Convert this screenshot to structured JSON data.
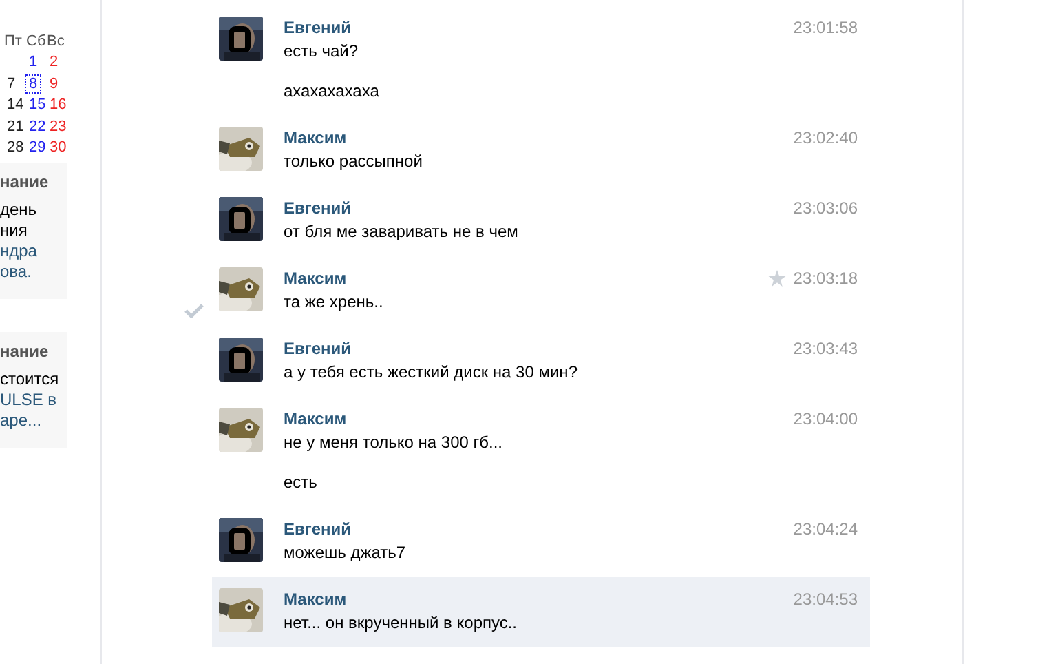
{
  "calendar": {
    "weekdays": [
      "Пт",
      "Сб",
      "Вс"
    ],
    "weeks": [
      [
        {
          "day": "1",
          "kind": "saturday",
          "selected": false
        },
        {
          "day": "2",
          "kind": "sunday",
          "selected": false
        }
      ],
      [
        {
          "day": "7",
          "kind": "weekday",
          "selected": false
        },
        {
          "day": "8",
          "kind": "saturday",
          "selected": true
        },
        {
          "day": "9",
          "kind": "sunday",
          "selected": false
        }
      ],
      [
        {
          "day": "14",
          "kind": "weekday",
          "selected": false
        },
        {
          "day": "15",
          "kind": "saturday",
          "selected": false
        },
        {
          "day": "16",
          "kind": "sunday",
          "selected": false
        }
      ],
      [
        {
          "day": "21",
          "kind": "weekday",
          "selected": false
        },
        {
          "day": "22",
          "kind": "saturday",
          "selected": false
        },
        {
          "day": "23",
          "kind": "sunday",
          "selected": false
        }
      ],
      [
        {
          "day": "28",
          "kind": "weekday",
          "selected": false
        },
        {
          "day": "29",
          "kind": "saturday",
          "selected": false
        },
        {
          "day": "30",
          "kind": "sunday",
          "selected": false
        }
      ]
    ]
  },
  "reminders": [
    {
      "title": "нание",
      "lines": [
        {
          "text": "день",
          "kind": "plain"
        },
        {
          "text": "ния",
          "kind": "plain"
        },
        {
          "text": "ндра",
          "kind": "link"
        },
        {
          "text": "ова.",
          "kind": "link"
        }
      ]
    },
    {
      "title": "нание",
      "lines": [
        {
          "text": "стоится",
          "kind": "plain"
        },
        {
          "text": "ULSE в",
          "kind": "link"
        },
        {
          "text": "аре...",
          "kind": "link"
        }
      ]
    }
  ],
  "messages": [
    {
      "sender": "Евгений",
      "time": "23:01:58",
      "texts": [
        "есть чай?",
        "ахахахахаха"
      ],
      "starred": false,
      "check_shown": false,
      "highlighted": false
    },
    {
      "sender": "Максим",
      "time": "23:02:40",
      "texts": [
        "только рассыпной"
      ],
      "starred": false,
      "check_shown": false,
      "highlighted": false
    },
    {
      "sender": "Евгений",
      "time": "23:03:06",
      "texts": [
        "от бля ме заваривать не в чем"
      ],
      "starred": false,
      "check_shown": false,
      "highlighted": false
    },
    {
      "sender": "Максим",
      "time": "23:03:18",
      "texts": [
        "та же хрень.."
      ],
      "starred": true,
      "check_shown": true,
      "highlighted": false
    },
    {
      "sender": "Евгений",
      "time": "23:03:43",
      "texts": [
        "а у тебя есть жесткий диск на 30 мин?"
      ],
      "starred": false,
      "check_shown": false,
      "highlighted": false
    },
    {
      "sender": "Максим",
      "time": "23:04:00",
      "texts": [
        "не у меня только на 300 гб...",
        "есть"
      ],
      "starred": false,
      "check_shown": false,
      "highlighted": false
    },
    {
      "sender": "Евгений",
      "time": "23:04:24",
      "texts": [
        "можешь джать7"
      ],
      "starred": false,
      "check_shown": false,
      "highlighted": false
    },
    {
      "sender": "Максим",
      "time": "23:04:53",
      "texts": [
        "нет... он вкрученный в корпус.."
      ],
      "starred": false,
      "check_shown": false,
      "highlighted": true
    }
  ]
}
